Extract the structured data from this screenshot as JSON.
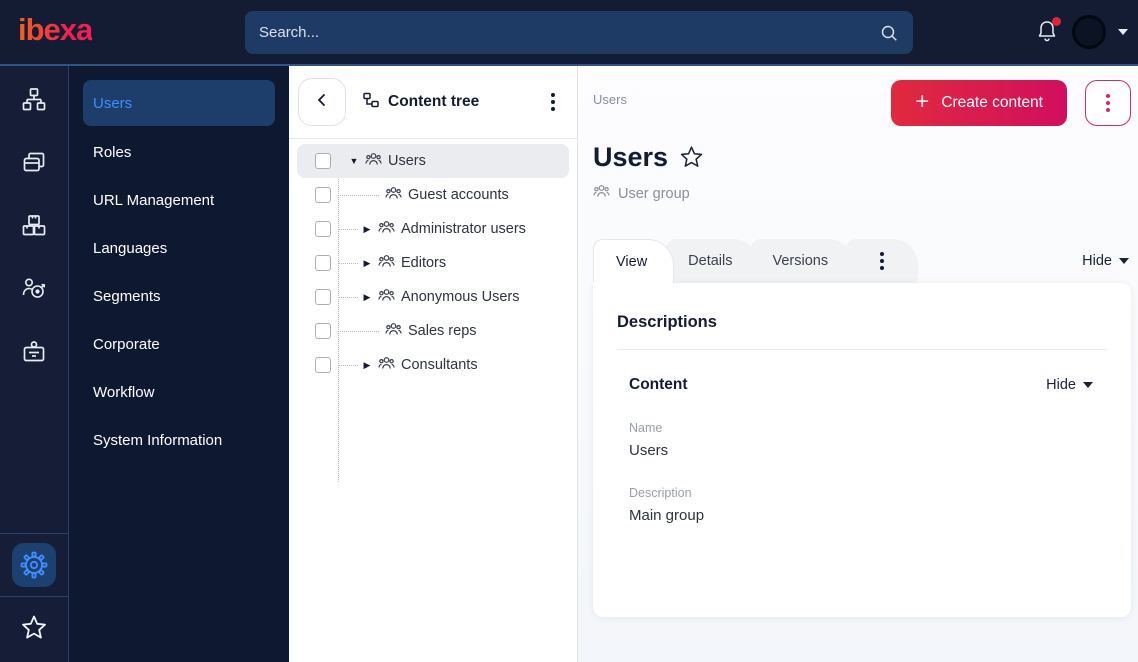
{
  "topbar": {
    "logo_text": "ibexa",
    "search_placeholder": "Search...",
    "notification_badge": true
  },
  "colors": {
    "topbar_bg": "#131c33",
    "topbar_divider": "#2e5386",
    "sidebar_bg": "#0e1830",
    "sidebar_selected_bg": "#1d3d6b",
    "accent_blue": "#3e8eff",
    "brand_gradient_start": "#e02a3e",
    "brand_gradient_end": "#d10e5e",
    "kebab_pink": "#cf2b69",
    "logo_gradient_start": "#f2641c",
    "logo_gradient_end": "#f01f57"
  },
  "icons": {
    "search": "magnifier",
    "bell": "notification-bell with red dot",
    "avatar": "dark circle",
    "rail": [
      "sitemap",
      "pages",
      "product-boxes",
      "audience-target",
      "id-badge",
      "gear (active)",
      "star"
    ],
    "content_tree": "hierarchy-squares",
    "user_group": "three-people-outline",
    "favorite": "star-outline",
    "expand_collapsed": "right-triangle",
    "expand_open": "down-triangle"
  },
  "sidebar": {
    "items": [
      {
        "label": "Users",
        "selected": true
      },
      {
        "label": "Roles",
        "selected": false
      },
      {
        "label": "URL Management",
        "selected": false
      },
      {
        "label": "Languages",
        "selected": false
      },
      {
        "label": "Segments",
        "selected": false
      },
      {
        "label": "Corporate",
        "selected": false
      },
      {
        "label": "Workflow",
        "selected": false
      },
      {
        "label": "System Information",
        "selected": false
      }
    ]
  },
  "content_tree": {
    "title": "Content tree",
    "items": [
      {
        "label": "Users",
        "level": 0,
        "has_children": true,
        "expanded": true,
        "selected": true
      },
      {
        "label": "Guest accounts",
        "level": 1,
        "has_children": false,
        "expanded": false,
        "selected": false
      },
      {
        "label": "Administrator users",
        "level": 1,
        "has_children": true,
        "expanded": false,
        "selected": false
      },
      {
        "label": "Editors",
        "level": 1,
        "has_children": true,
        "expanded": false,
        "selected": false
      },
      {
        "label": "Anonymous Users",
        "level": 1,
        "has_children": true,
        "expanded": false,
        "selected": false
      },
      {
        "label": "Sales reps",
        "level": 1,
        "has_children": false,
        "expanded": false,
        "selected": false
      },
      {
        "label": "Consultants",
        "level": 1,
        "has_children": true,
        "expanded": false,
        "selected": false
      }
    ]
  },
  "main": {
    "breadcrumb": "Users",
    "create_button_label": "Create content",
    "page_title": "Users",
    "content_type": "User group",
    "tabs": [
      "View",
      "Details",
      "Versions"
    ],
    "active_tab": "View",
    "hide_label": "Hide",
    "card": {
      "descriptions_title": "Descriptions",
      "content_section_title": "Content",
      "content_hide_label": "Hide",
      "fields": [
        {
          "label": "Name",
          "value": "Users"
        },
        {
          "label": "Description",
          "value": "Main group"
        }
      ]
    }
  }
}
